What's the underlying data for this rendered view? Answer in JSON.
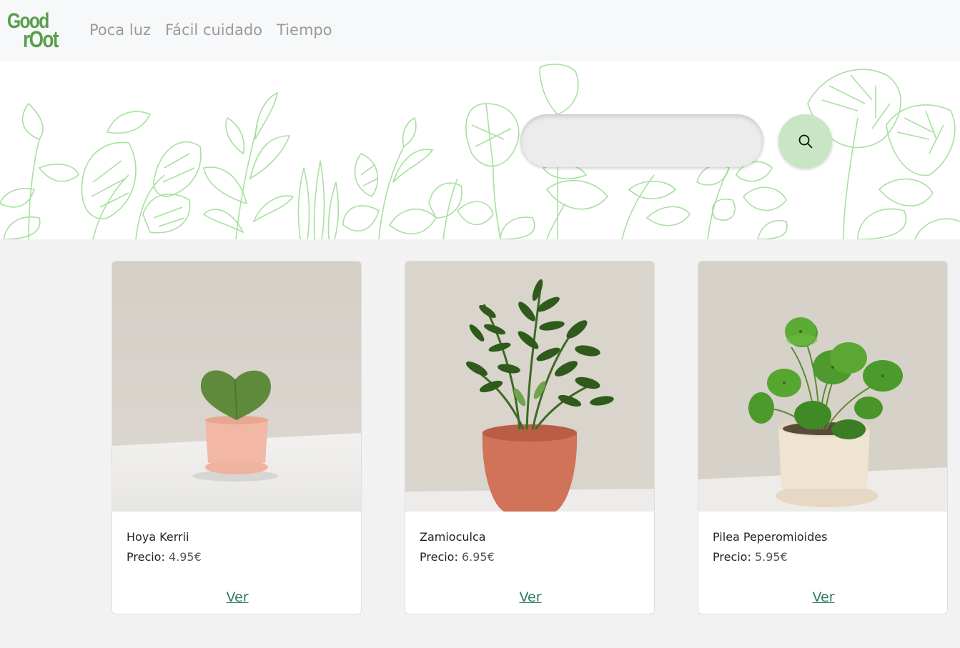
{
  "brand": {
    "logo_line1": "Good",
    "logo_line2": "rOot",
    "color": "#5a9e4a"
  },
  "nav": {
    "links": [
      {
        "label": "Poca luz"
      },
      {
        "label": "Fácil cuidado"
      },
      {
        "label": "Tiempo"
      }
    ]
  },
  "search": {
    "placeholder": "",
    "value": "",
    "icon": "search-icon",
    "button_color": "#c8e6c4"
  },
  "products": [
    {
      "name": "Hoya Kerrii",
      "price_label": "Precio:",
      "price": "4.95€",
      "action": "Ver"
    },
    {
      "name": "Zamioculca",
      "price_label": "Precio:",
      "price": "6.95€",
      "action": "Ver"
    },
    {
      "name": "Pilea Peperomioides",
      "price_label": "Precio:",
      "price": "5.95€",
      "action": "Ver"
    }
  ],
  "colors": {
    "accent": "#2e7d5b",
    "leaf_outline": "#a8e0a0",
    "page_bg": "#f2f2f2"
  }
}
